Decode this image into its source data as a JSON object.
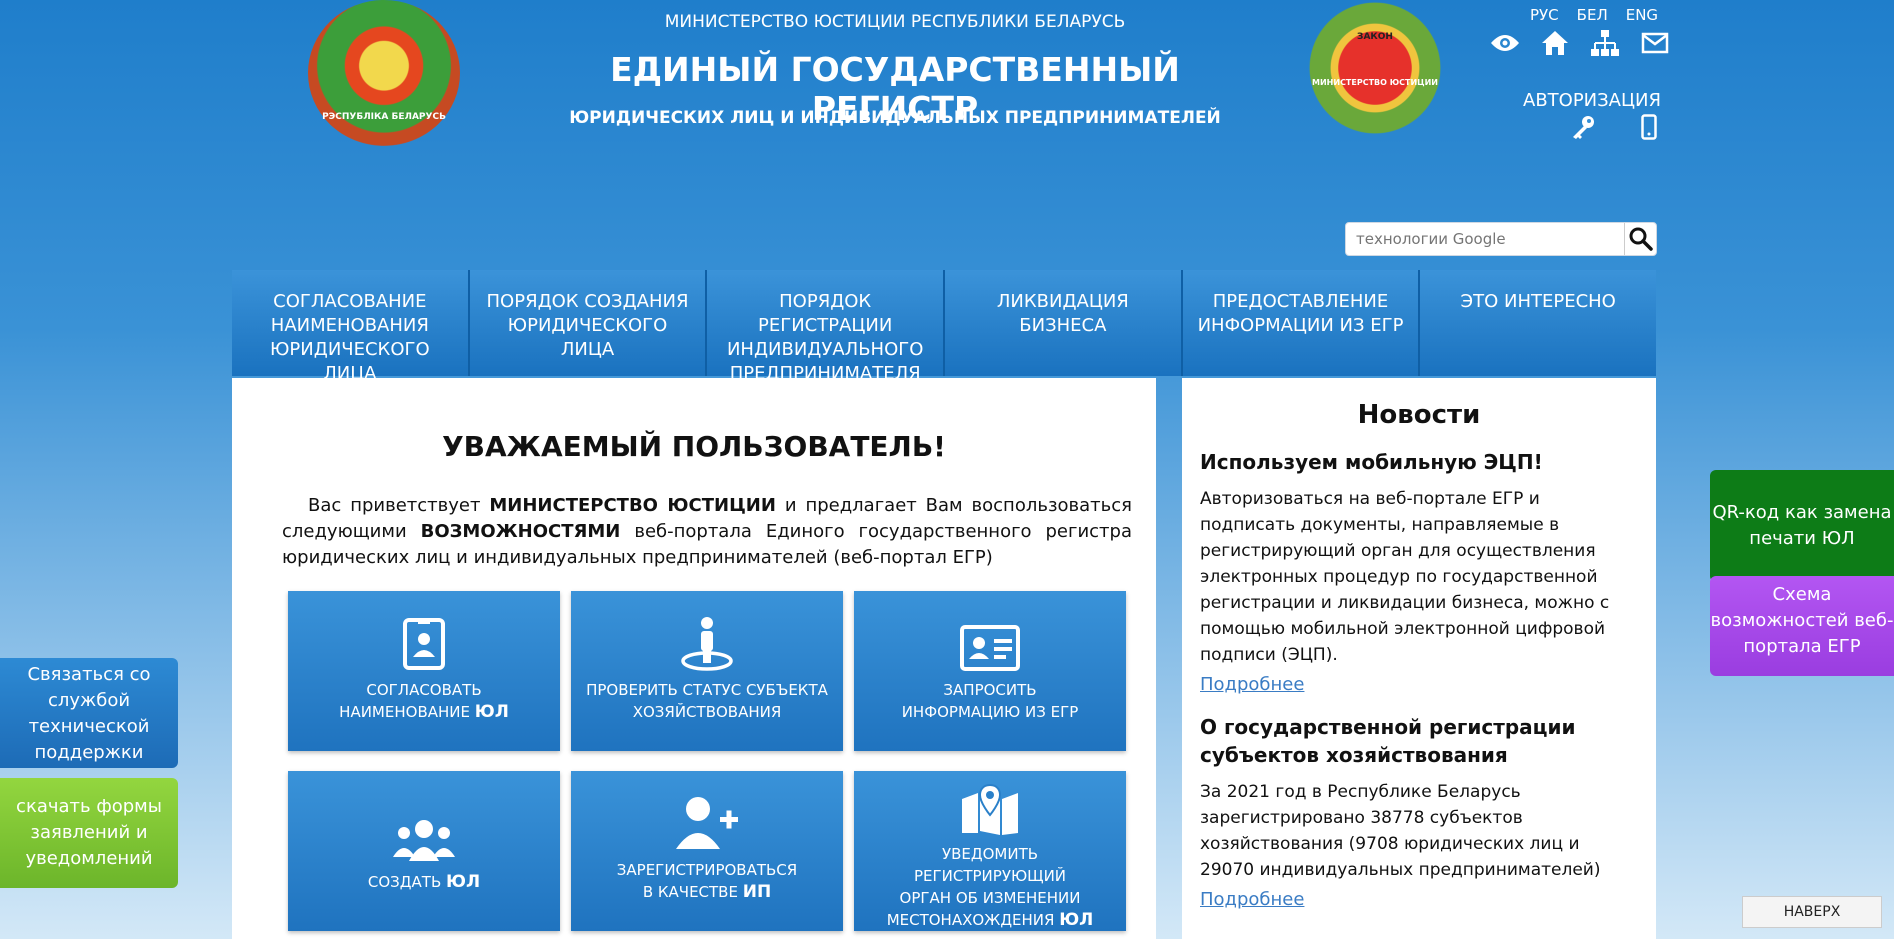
{
  "header": {
    "ministry": "МИНИСТЕРСТВО ЮСТИЦИИ РЕСПУБЛИКИ БЕЛАРУСЬ",
    "title": "ЕДИНЫЙ ГОСУДАРСТВЕННЫЙ РЕГИСТР",
    "subtitle": "ЮРИДИЧЕСКИХ ЛИЦ И ИНДИВИДУАЛЬНЫХ ПРЕДПРИНИМАТЕЛЕЙ",
    "emblem_left_text": "РЭСПУБЛІКА БЕЛАРУСЬ",
    "emblem_right_text": "МИНИСТЕРСТВО ЮСТИЦИИ",
    "emblem_right_top": "ЗАКОН"
  },
  "langs": [
    "РУС",
    "БЕЛ",
    "ENG"
  ],
  "auth": {
    "label": "АВТОРИЗАЦИЯ"
  },
  "search": {
    "placeholder": "технологии Google"
  },
  "nav": [
    "СОГЛАСОВАНИЕ НАИМЕНОВАНИЯ ЮРИДИЧЕСКОГО ЛИЦА",
    "ПОРЯДОК СОЗДАНИЯ ЮРИДИЧЕСКОГО ЛИЦА",
    "ПОРЯДОК РЕГИСТРАЦИИ ИНДИВИДУАЛЬНОГО ПРЕДПРИНИМАТЕЛЯ",
    "ЛИКВИДАЦИЯ БИЗНЕСА",
    "ПРЕДОСТАВЛЕНИЕ ИНФОРМАЦИИ ИЗ ЕГР",
    "ЭТО ИНТЕРЕСНО"
  ],
  "main": {
    "title": "УВАЖАЕМЫЙ ПОЛЬЗОВАТЕЛЬ!",
    "intro_1": "Вас приветствует ",
    "intro_b1": "МИНИСТЕРСТВО ЮСТИЦИИ",
    "intro_2": " и предлагает Вам воспользоваться следующими ",
    "intro_b2": "ВОЗМОЖНОСТЯМИ",
    "intro_3": " веб-портала Единого государственного регистра юридических лиц и индивидуальных предпринимателей (веб-портал ЕГР)"
  },
  "tiles": [
    {
      "line1": "СОГЛАСОВАТЬ",
      "line2": "НАИМЕНОВАНИЕ ",
      "bold": "ЮЛ",
      "icon": "id-badge-icon"
    },
    {
      "line1": "ПРОВЕРИТЬ СТАТУС СУБЪЕКТА",
      "line2": "ХОЗЯЙСТВОВАНИЯ",
      "bold": "",
      "icon": "person-status-icon"
    },
    {
      "line1": "ЗАПРОСИТЬ",
      "line2": "ИНФОРМАЦИЮ ИЗ ЕГР",
      "bold": "",
      "icon": "id-card-icon"
    },
    {
      "line1": "",
      "line2": "СОЗДАТЬ ",
      "bold": "ЮЛ",
      "icon": "users-icon"
    },
    {
      "line1": "ЗАРЕГИСТРИРОВАТЬСЯ",
      "line2": "В КАЧЕСТВЕ ",
      "bold": "ИП",
      "icon": "user-plus-icon"
    },
    {
      "line1": "УВЕДОМИТЬ РЕГИСТРИРУЮЩИЙ",
      "line2": "ОРГАН ОБ ИЗМЕНЕНИИ",
      "line3": "МЕСТОНАХОЖДЕНИЯ ",
      "bold": "ЮЛ",
      "icon": "map-pin-icon"
    }
  ],
  "news": {
    "title": "Новости",
    "items": [
      {
        "heading": "Используем мобильную ЭЦП!",
        "text": "Авторизоваться на веб-портале ЕГР и подписать документы, направляемые в регистрирующий орган для осуществления электронных процедур по государственной регистрации и ликвидации бизнеса, можно с помощью мобильной электронной цифровой подписи (ЭЦП).",
        "more": "Подробнее"
      },
      {
        "heading": "О государственной регистрации субъектов хозяйствования",
        "text": "За 2021 год в Республике Беларусь зарегистрировано 38778 субъектов хозяйствования (9708 юридических лиц и 29070 индивидуальных предпринимателей)",
        "more": "Подробнее"
      }
    ]
  },
  "side": {
    "support": "Связаться со службой технической поддержки",
    "forms": "скачать формы заявлений и уведомлений",
    "qr": "QR-код как замена печати ЮЛ",
    "scheme": "Схема возможностей веб-портала ЕГР",
    "totop": "НАВЕРХ"
  }
}
